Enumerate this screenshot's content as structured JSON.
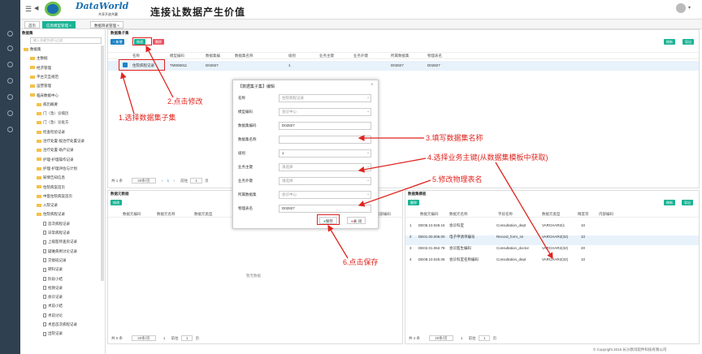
{
  "app": {
    "logo": "DataWorld",
    "logo_sub": "共享开放共赢",
    "slogan": "连接让数据产生价值"
  },
  "tabs": [
    "首页",
    "信息模型管理 ×",
    "数据目录管理 ×"
  ],
  "tree": {
    "title": "数据集",
    "search_placeholder": "输入关键字进行过滤",
    "items": [
      [
        "数据集",
        0,
        "fold"
      ],
      [
        "主数据",
        1,
        "fold"
      ],
      [
        "经济管理",
        1,
        "fold"
      ],
      [
        "平台交互规范",
        1,
        "fold"
      ],
      [
        "运营管理",
        1,
        "fold"
      ],
      [
        "临床数据中心",
        1,
        "fold"
      ],
      [
        "病历概要",
        2,
        "fold"
      ],
      [
        "门（急）诊病历",
        2,
        "fold"
      ],
      [
        "门（急）诊处方",
        2,
        "fold"
      ],
      [
        "检查检验记录",
        2,
        "fold"
      ],
      [
        "治疗处置-般治疗处置记录",
        2,
        "fold"
      ],
      [
        "治疗处置-助产记录",
        2,
        "fold"
      ],
      [
        "护理-护理操作记录",
        2,
        "fold"
      ],
      [
        "护理-护理评估与计划",
        2,
        "fold"
      ],
      [
        "知情告知信息",
        2,
        "fold"
      ],
      [
        "住院病案首页",
        2,
        "fold"
      ],
      [
        "中医住院病案首页",
        2,
        "fold"
      ],
      [
        "入院记录",
        2,
        "fold"
      ],
      [
        "住院病程记录",
        2,
        "fold"
      ],
      [
        "首次病程记录",
        3,
        "doc"
      ],
      [
        "日常病程记录",
        3,
        "doc"
      ],
      [
        "上级医师查房记录",
        3,
        "doc"
      ],
      [
        "疑难病例讨论记录",
        3,
        "doc"
      ],
      [
        "交接班记录",
        3,
        "doc"
      ],
      [
        "转科记录",
        3,
        "doc"
      ],
      [
        "阶段小结",
        3,
        "doc"
      ],
      [
        "抢救记录",
        3,
        "doc"
      ],
      [
        "会诊记录",
        3,
        "doc"
      ],
      [
        "术前小结",
        3,
        "doc"
      ],
      [
        "术前讨论",
        3,
        "doc"
      ],
      [
        "术后首次病程记录",
        3,
        "doc"
      ],
      [
        "出院记录",
        3,
        "doc"
      ]
    ]
  },
  "subset_panel": {
    "title": "数据集子集",
    "buttons": [
      "+ 新增",
      "修改",
      "删除"
    ],
    "right_buttons": [
      "刷新",
      "导出"
    ],
    "headers": [
      "名称",
      "模型编码",
      "数据集编",
      "数据集名称",
      "级别",
      "业务主键",
      "业务外键",
      "所属数据集",
      "物理表名"
    ],
    "row": [
      "住院病程记录",
      "TM006011",
      "D02827",
      "",
      "1",
      "",
      "",
      "D02827",
      "D02827"
    ],
    "pager": {
      "total": "共 1 条",
      "size": "20条/页",
      "goto": "前往",
      "page": "1",
      "pg": "页"
    }
  },
  "meta_panel": {
    "title": "数据元数据",
    "buttons": [
      "修改"
    ],
    "headers": [
      "数据元编码",
      "数据元名称",
      "数据元类型",
      "内部编码"
    ],
    "empty": "暂无数据",
    "pager": {
      "total": "共 0 条",
      "size": "20条/页",
      "goto": "前往",
      "page": "1",
      "pg": "页"
    }
  },
  "tmpl_panel": {
    "title": "数据集模板",
    "buttons": [
      "删除"
    ],
    "right_buttons": [
      "刷新",
      "导出"
    ],
    "headers": [
      "数据元编码",
      "数据元名称",
      "字段名称",
      "数据元类型",
      "精度等",
      "内部编码"
    ],
    "rows": [
      [
        "1",
        "DE06.10.026.16",
        "会诊科室",
        "Consultation_dept",
        "VARCHAR2(1",
        "10",
        ""
      ],
      [
        "2",
        "DE01.00.006.00",
        "电子申请单编号",
        "Record_form_sn",
        "VARCHAR2(32)",
        "10",
        ""
      ],
      [
        "3",
        "DE02.01.062.78",
        "会诊医生编码",
        "Consultation_doctor",
        "VARCHAR2(32)",
        "20",
        ""
      ],
      [
        "4",
        "DE08.10.025.06",
        "会诊科室名称编码",
        "Consultation_dept",
        "VARCHAR2(32)",
        "10",
        ""
      ]
    ],
    "pager": {
      "total": "共 4 条",
      "size": "20条/页",
      "goto": "前往",
      "page": "1",
      "pg": "页"
    }
  },
  "modal": {
    "title": "【数据集子集】编辑",
    "fields": [
      [
        "名称",
        "住院病程记录",
        true
      ],
      [
        "模型编码",
        "会诊中心",
        true
      ],
      [
        "数据集编码",
        "D02827",
        false
      ],
      [
        "数据集名称",
        "",
        false
      ],
      [
        "级别",
        "1",
        true
      ],
      [
        "业务主键",
        "请选择",
        true
      ],
      [
        "业务外键",
        "请选择",
        true
      ],
      [
        "所属数据集",
        "会诊中心",
        true
      ],
      [
        "物理表名",
        "D02827",
        false
      ]
    ],
    "save": "保存",
    "close": "关 闭"
  },
  "annotations": [
    "1.选择数据集子集",
    "2.点击修改",
    "3.填写数据集名称",
    "4.选择业务主键(从数据集模板中获取)",
    "5.修改物理表名",
    "6.点击保存"
  ],
  "footer": "© Copyright 2016 长沙默讯软件科技有限公司",
  "colors": {
    "sidebar": "#2f4050",
    "accent": "#1ab394",
    "blue": "#1c84c6",
    "red": "#ed5565",
    "annotation": "#e0251f"
  }
}
